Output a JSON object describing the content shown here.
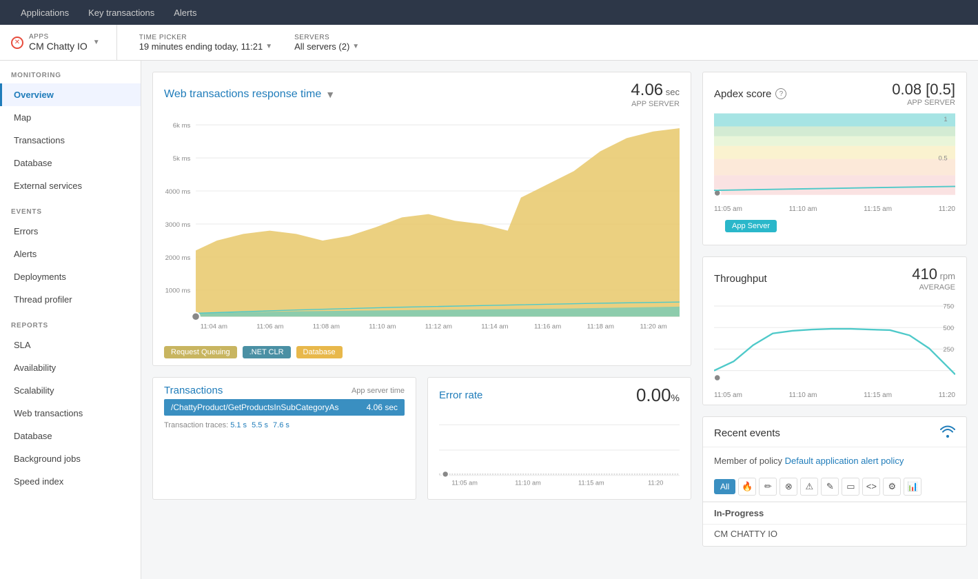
{
  "topNav": {
    "items": [
      "Applications",
      "Key transactions",
      "Alerts"
    ]
  },
  "breadcrumb": {
    "apps_label": "APPS",
    "app_name": "CM Chatty IO",
    "time_picker_label": "TIME PICKER",
    "time_picker_value": "19 minutes ending today, 11:21",
    "servers_label": "SERVERS",
    "servers_value": "All servers (2)"
  },
  "sidebar": {
    "monitoring_label": "MONITORING",
    "monitoring_items": [
      {
        "label": "Overview",
        "active": true
      },
      {
        "label": "Map",
        "active": false
      },
      {
        "label": "Transactions",
        "active": false
      },
      {
        "label": "Database",
        "active": false
      },
      {
        "label": "External services",
        "active": false
      }
    ],
    "events_label": "EVENTS",
    "events_items": [
      {
        "label": "Errors",
        "active": false
      },
      {
        "label": "Alerts",
        "active": false
      },
      {
        "label": "Deployments",
        "active": false
      },
      {
        "label": "Thread profiler",
        "active": false
      }
    ],
    "reports_label": "REPORTS",
    "reports_items": [
      {
        "label": "SLA",
        "active": false
      },
      {
        "label": "Availability",
        "active": false
      },
      {
        "label": "Scalability",
        "active": false
      },
      {
        "label": "Web transactions",
        "active": false
      },
      {
        "label": "Database",
        "active": false
      },
      {
        "label": "Background jobs",
        "active": false
      },
      {
        "label": "Speed index",
        "active": false
      }
    ]
  },
  "mainChart": {
    "title": "Web transactions response time",
    "value": "4.06",
    "unit": "sec",
    "server_label": "APP SERVER",
    "y_labels": [
      "6k ms",
      "5k ms",
      "4000 ms",
      "3000 ms",
      "2000 ms",
      "1000 ms"
    ],
    "x_labels": [
      "11:04 am",
      "11:06 am",
      "11:08 am",
      "11:10 am",
      "11:12 am",
      "11:14 am",
      "11:16 am",
      "11:18 am",
      "11:20 am"
    ],
    "legend": [
      {
        "label": "Request Queuing",
        "color": "#c8b560"
      },
      {
        "label": ".NET CLR",
        "color": "#4a90a4"
      },
      {
        "label": "Database",
        "color": "#e8b84b"
      }
    ]
  },
  "apdexChart": {
    "title": "Apdex score",
    "help_icon": "?",
    "value": "0.08 [0.5]",
    "server_label": "APP SERVER",
    "badge_label": "App Server",
    "y_labels": [
      "1",
      "0.5"
    ],
    "x_labels": [
      "11:05 am",
      "11:10 am",
      "11:15 am",
      "11:20"
    ]
  },
  "throughputChart": {
    "title": "Throughput",
    "value": "410",
    "unit": "rpm",
    "avg_label": "AVERAGE",
    "y_labels": [
      "750",
      "500",
      "250"
    ],
    "x_labels": [
      "11:05 am",
      "11:10 am",
      "11:15 am",
      "11:20"
    ]
  },
  "transactionsPanel": {
    "title": "Transactions",
    "subtitle": "App server time",
    "row": {
      "name": "/ChattyProduct/GetProductsInSubCategoryAs",
      "value": "4.06 sec"
    },
    "traces_label": "Transaction traces:",
    "traces": [
      "5.1 s",
      "5.5 s",
      "7.6 s"
    ]
  },
  "errorRatePanel": {
    "title": "Error rate",
    "value": "0.00",
    "unit": "%",
    "x_labels": [
      "11:05 am",
      "11:10 am",
      "11:15 am",
      "11:20"
    ]
  },
  "recentEvents": {
    "title": "Recent events",
    "policy_text": "Member of policy",
    "policy_link": "Default application alert policy",
    "filters": {
      "all": "All",
      "icons": [
        "🔥",
        "✏️",
        "⊗",
        "⚠",
        "✎",
        "▭",
        "<>",
        "⚙",
        "📊"
      ]
    },
    "in_progress_label": "In-Progress",
    "cm_chatty_label": "CM CHATTY IO"
  }
}
